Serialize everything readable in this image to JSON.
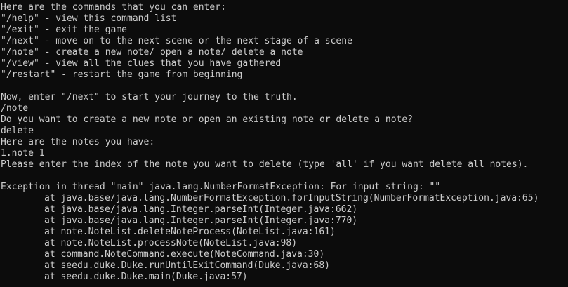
{
  "terminal": {
    "lines": [
      {
        "text": "Here are the commands that you can enter:",
        "indent": false
      },
      {
        "text": "\"/help\" - view this command list",
        "indent": false
      },
      {
        "text": "\"/exit\" - exit the game",
        "indent": false
      },
      {
        "text": "\"/next\" - move on to the next scene or the next stage of a scene",
        "indent": false
      },
      {
        "text": "\"/note\" - create a new note/ open a note/ delete a note",
        "indent": false
      },
      {
        "text": "\"/view\" - view all the clues that you have gathered",
        "indent": false
      },
      {
        "text": "\"/restart\" - restart the game from beginning",
        "indent": false
      },
      {
        "text": "",
        "indent": false
      },
      {
        "text": "Now, enter \"/next\" to start your journey to the truth.",
        "indent": false
      },
      {
        "text": "/note",
        "indent": false
      },
      {
        "text": "Do you want to create a new note or open an existing note or delete a note?",
        "indent": false
      },
      {
        "text": "delete",
        "indent": false
      },
      {
        "text": "Here are the notes you have:",
        "indent": false
      },
      {
        "text": "1.note 1",
        "indent": false
      },
      {
        "text": "Please enter the index of the note you want to delete (type 'all' if you want delete all notes).",
        "indent": false
      },
      {
        "text": "",
        "indent": false
      },
      {
        "text": "Exception in thread \"main\" java.lang.NumberFormatException: For input string: \"\"",
        "indent": false
      },
      {
        "text": "at java.base/java.lang.NumberFormatException.forInputString(NumberFormatException.java:65)",
        "indent": true
      },
      {
        "text": "at java.base/java.lang.Integer.parseInt(Integer.java:662)",
        "indent": true
      },
      {
        "text": "at java.base/java.lang.Integer.parseInt(Integer.java:770)",
        "indent": true
      },
      {
        "text": "at note.NoteList.deleteNoteProcess(NoteList.java:161)",
        "indent": true
      },
      {
        "text": "at note.NoteList.processNote(NoteList.java:98)",
        "indent": true
      },
      {
        "text": "at command.NoteCommand.execute(NoteCommand.java:30)",
        "indent": true
      },
      {
        "text": "at seedu.duke.Duke.runUntilExitCommand(Duke.java:68)",
        "indent": true
      },
      {
        "text": "at seedu.duke.Duke.main(Duke.java:57)",
        "indent": true
      }
    ]
  }
}
